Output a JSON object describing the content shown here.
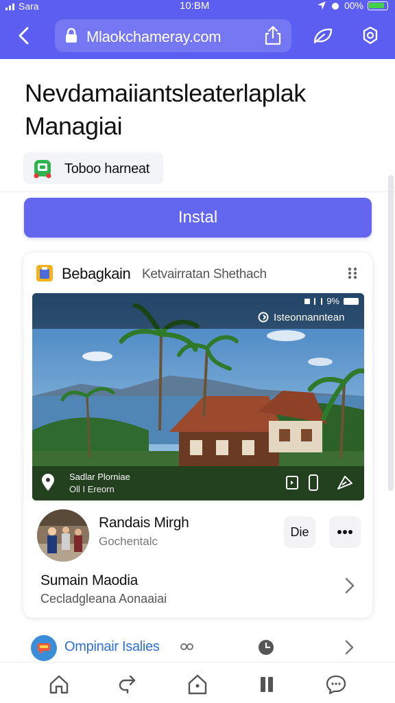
{
  "status_bar": {
    "carrier": "Sara",
    "time": "10:BM",
    "battery": "00%"
  },
  "browser": {
    "url": "Mlaokchameray.com"
  },
  "page": {
    "title": "Nevdamaiiantsleaterlaplak Managiai",
    "tag_label": "Toboo harneat",
    "install_label": "Instal"
  },
  "card": {
    "title": "Bebagkain",
    "subtitle": "Ketvairratan Shethach",
    "photo": {
      "status": "9%",
      "badge": "Isteonnanntean",
      "location_name": "Sadlar Plorniae",
      "location_sub": "Oll I Ereorn"
    },
    "person": {
      "name": "Randais Mirgh",
      "role": "Gochentalc",
      "action_label": "Die"
    },
    "row": {
      "title": "Sumain Maodia",
      "subtitle": "Cecladgleana Aonaaiai"
    }
  },
  "promo": {
    "text": "Ompinair Isalies"
  },
  "colors": {
    "accent": "#5b5ef0",
    "button": "#6366ef",
    "link": "#2e6fd8"
  },
  "icons": [
    "back-icon",
    "lock-icon",
    "share-icon",
    "leaf-icon",
    "settings-icon",
    "app-icon",
    "drag-icon",
    "location-icon",
    "home-icon",
    "redo-icon",
    "house-icon",
    "pause-icon",
    "chat-icon"
  ]
}
